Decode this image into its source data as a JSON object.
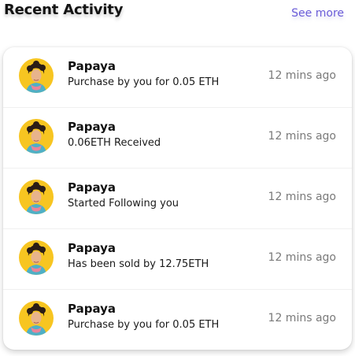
{
  "header": {
    "title": "Recent Activity",
    "see_more_label": "See more"
  },
  "colors": {
    "accent": "#6a5cd8",
    "avatar_bg": "#f7c521",
    "text_muted": "#7a7a7a"
  },
  "activity": [
    {
      "name": "Papaya",
      "description": "Purchase by you for 0.05 ETH",
      "time": "12 mins ago",
      "avatar_icon": "user-avatar-photo"
    },
    {
      "name": "Papaya",
      "description": "0.06ETH Received",
      "time": "12 mins ago",
      "avatar_icon": "user-avatar-photo"
    },
    {
      "name": "Papaya",
      "description": "Started Following you",
      "time": "12 mins ago",
      "avatar_icon": "user-avatar-photo"
    },
    {
      "name": "Papaya",
      "description": "Has been sold by 12.75ETH",
      "time": "12 mins ago",
      "avatar_icon": "user-avatar-photo"
    },
    {
      "name": "Papaya",
      "description": "Purchase by you for 0.05 ETH",
      "time": "12 mins ago",
      "avatar_icon": "user-avatar-photo"
    }
  ]
}
